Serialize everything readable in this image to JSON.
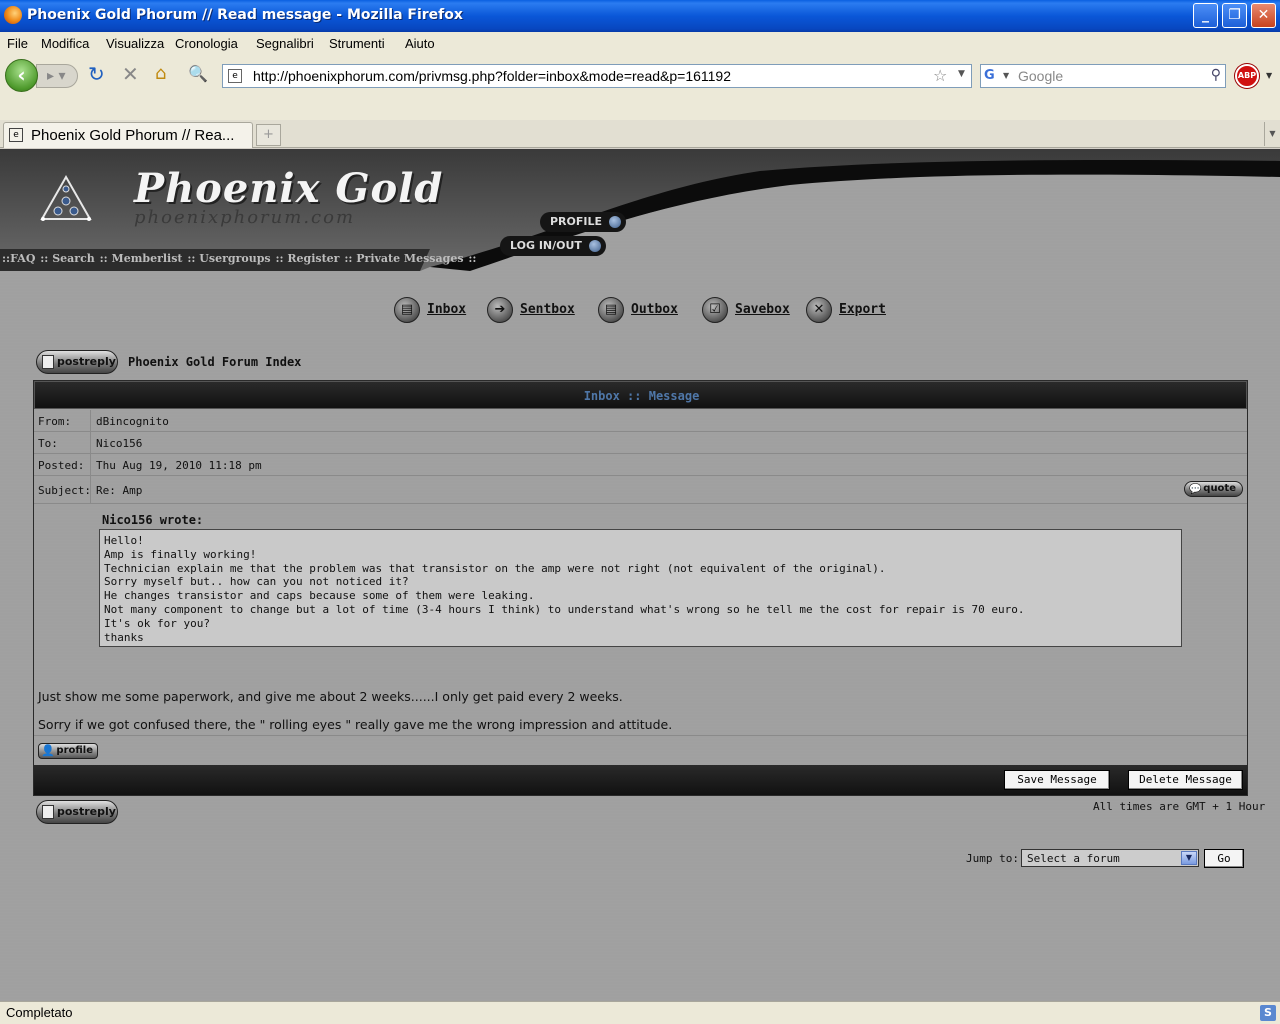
{
  "window": {
    "title": "Phoenix Gold Phorum // Read message - Mozilla Firefox"
  },
  "menu": [
    "File",
    "Modifica",
    "Visualizza",
    "Cronologia",
    "Segnalibri",
    "Strumenti",
    "Aiuto"
  ],
  "toolbar": {
    "url": "http://phoenixphorum.com/privmsg.php?folder=inbox&mode=read&p=161192",
    "search_placeholder": "Google",
    "abp_label": "ABP"
  },
  "tab": {
    "label": "Phoenix Gold Phorum // Rea..."
  },
  "header": {
    "logo_title": "Phoenix Gold",
    "logo_sub": "phoenixphorum.com",
    "profile": "PROFILE",
    "login": "LOG IN/OUT",
    "nav": [
      "::FAQ",
      ":: Search",
      ":: Memberlist",
      ":: Usergroups",
      " :: Register",
      " :: Private Messages",
      "::"
    ]
  },
  "pmnav": [
    "Inbox",
    "Sentbox",
    "Outbox",
    "Savebox",
    "Export"
  ],
  "breadcrumb": "Phoenix Gold Forum Index",
  "postreply_label": "postreply",
  "message": {
    "heading": "Inbox :: Message",
    "from_label": "From:",
    "from": "dBincognito",
    "to_label": "To:",
    "to": "Nico156",
    "posted_label": "Posted:",
    "posted": "Thu Aug 19, 2010 11:18 pm",
    "subject_label": "Subject:",
    "subject": "Re: Amp",
    "quote_label": "quote",
    "quote_author": "Nico156 wrote:",
    "quote_lines": [
      "Hello!",
      "Amp is finally working!",
      "Technician explain me that the problem was that transistor on the amp were not right (not equivalent of the original).",
      "Sorry myself but.. how can you not noticed it?",
      "He changes transistor and caps because some of them were leaking.",
      "Not many component to change but a lot of time (3-4 hours I think) to understand what's wrong so he tell me the cost for repair is 70 euro.",
      "It's ok for you?",
      "thanks"
    ],
    "reply_lines": [
      "Just show me some paperwork, and give me about 2 weeks......I only get paid every 2 weeks.",
      "Sorry if we got confused there, the \" rolling eyes \" really gave me the wrong impression and attitude."
    ],
    "profile_label": "profile",
    "save_label": "Save Message",
    "delete_label": "Delete Message"
  },
  "timezone": "All times are GMT + 1 Hour",
  "jump": {
    "label": "Jump to:",
    "selected": "Select a forum",
    "go": "Go"
  },
  "status": "Completato"
}
